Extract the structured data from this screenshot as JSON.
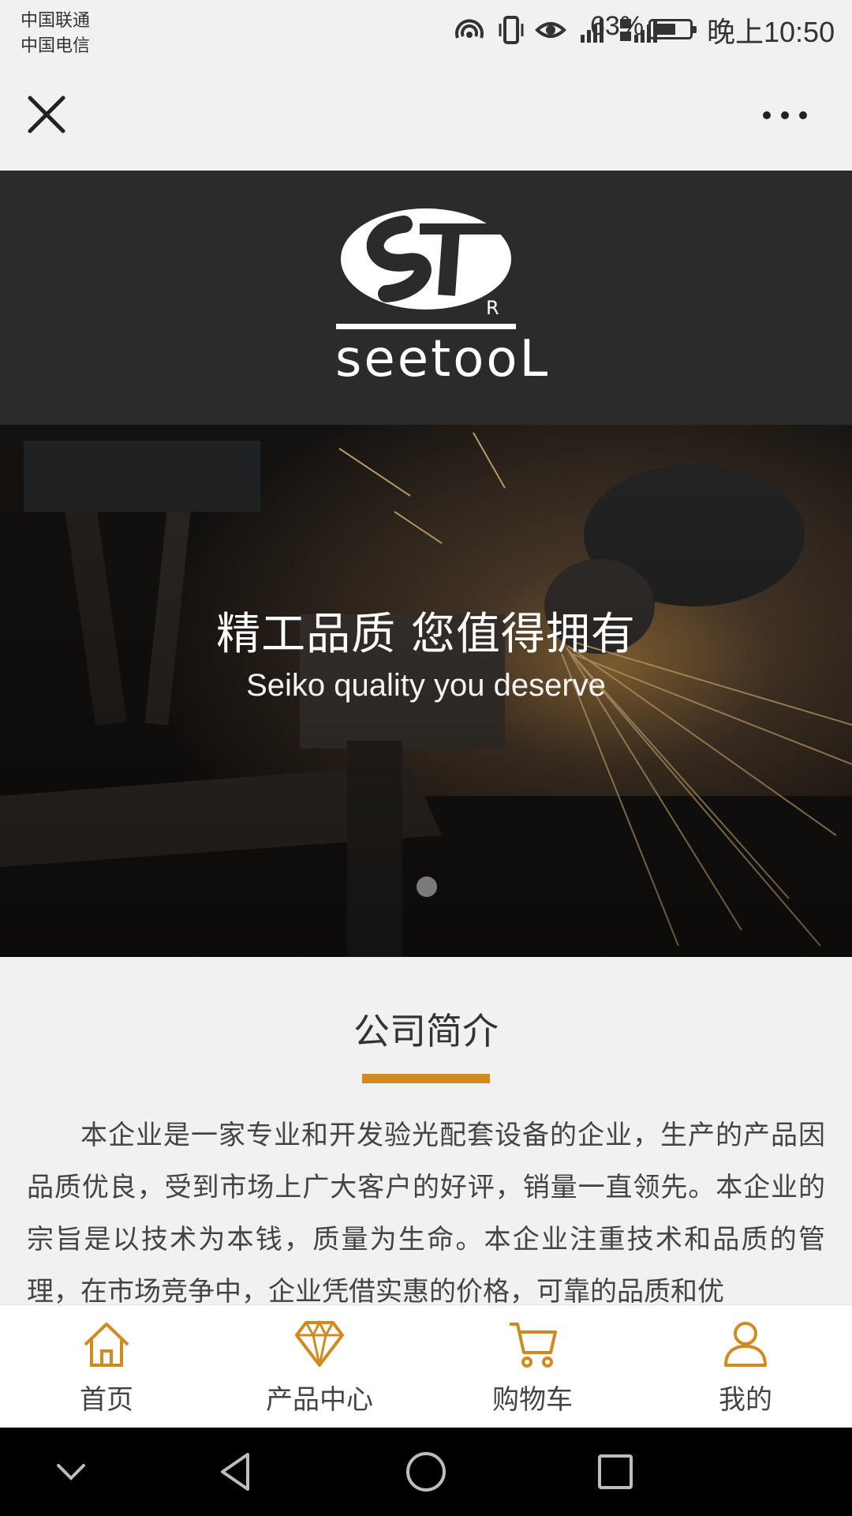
{
  "status_bar": {
    "carrier_1": "中国联通",
    "carrier_2": "中国电信",
    "battery_percent": "63%",
    "time": "晚上10:50",
    "battery_level": 0.63,
    "icons": [
      "hotspot-icon",
      "vibrate-icon",
      "eye-icon",
      "signal-icon",
      "signal-icon"
    ]
  },
  "top_nav": {
    "close_icon": "close-icon",
    "more_icon": "more-dots-icon"
  },
  "logo": {
    "mark": "ST",
    "registered": "R",
    "wordmark": "seetooL"
  },
  "hero": {
    "title": "精工品质 您值得拥有",
    "subtitle": "Seiko quality you deserve",
    "slide_count": 1,
    "active_slide": 1
  },
  "intro": {
    "heading": "公司简介",
    "body": "本企业是一家专业和开发验光配套设备的企业，生产的产品因品质优良，受到市场上广大客户的好评，销量一直领先。本企业的宗旨是以技术为本钱，质量为生命。本企业注重技术和品质的管理，在市场竞争中，企业凭借实惠的价格，可靠的品质和优"
  },
  "tabbar": {
    "items": [
      {
        "label": "首页",
        "icon": "home-icon"
      },
      {
        "label": "产品中心",
        "icon": "diamond-icon"
      },
      {
        "label": "购物车",
        "icon": "cart-icon"
      },
      {
        "label": "我的",
        "icon": "user-icon"
      }
    ],
    "accent_color": "#d08a1f"
  },
  "system_nav": {
    "icons": [
      "chevron-down-icon",
      "back-icon",
      "home-circle-icon",
      "recents-icon"
    ]
  }
}
